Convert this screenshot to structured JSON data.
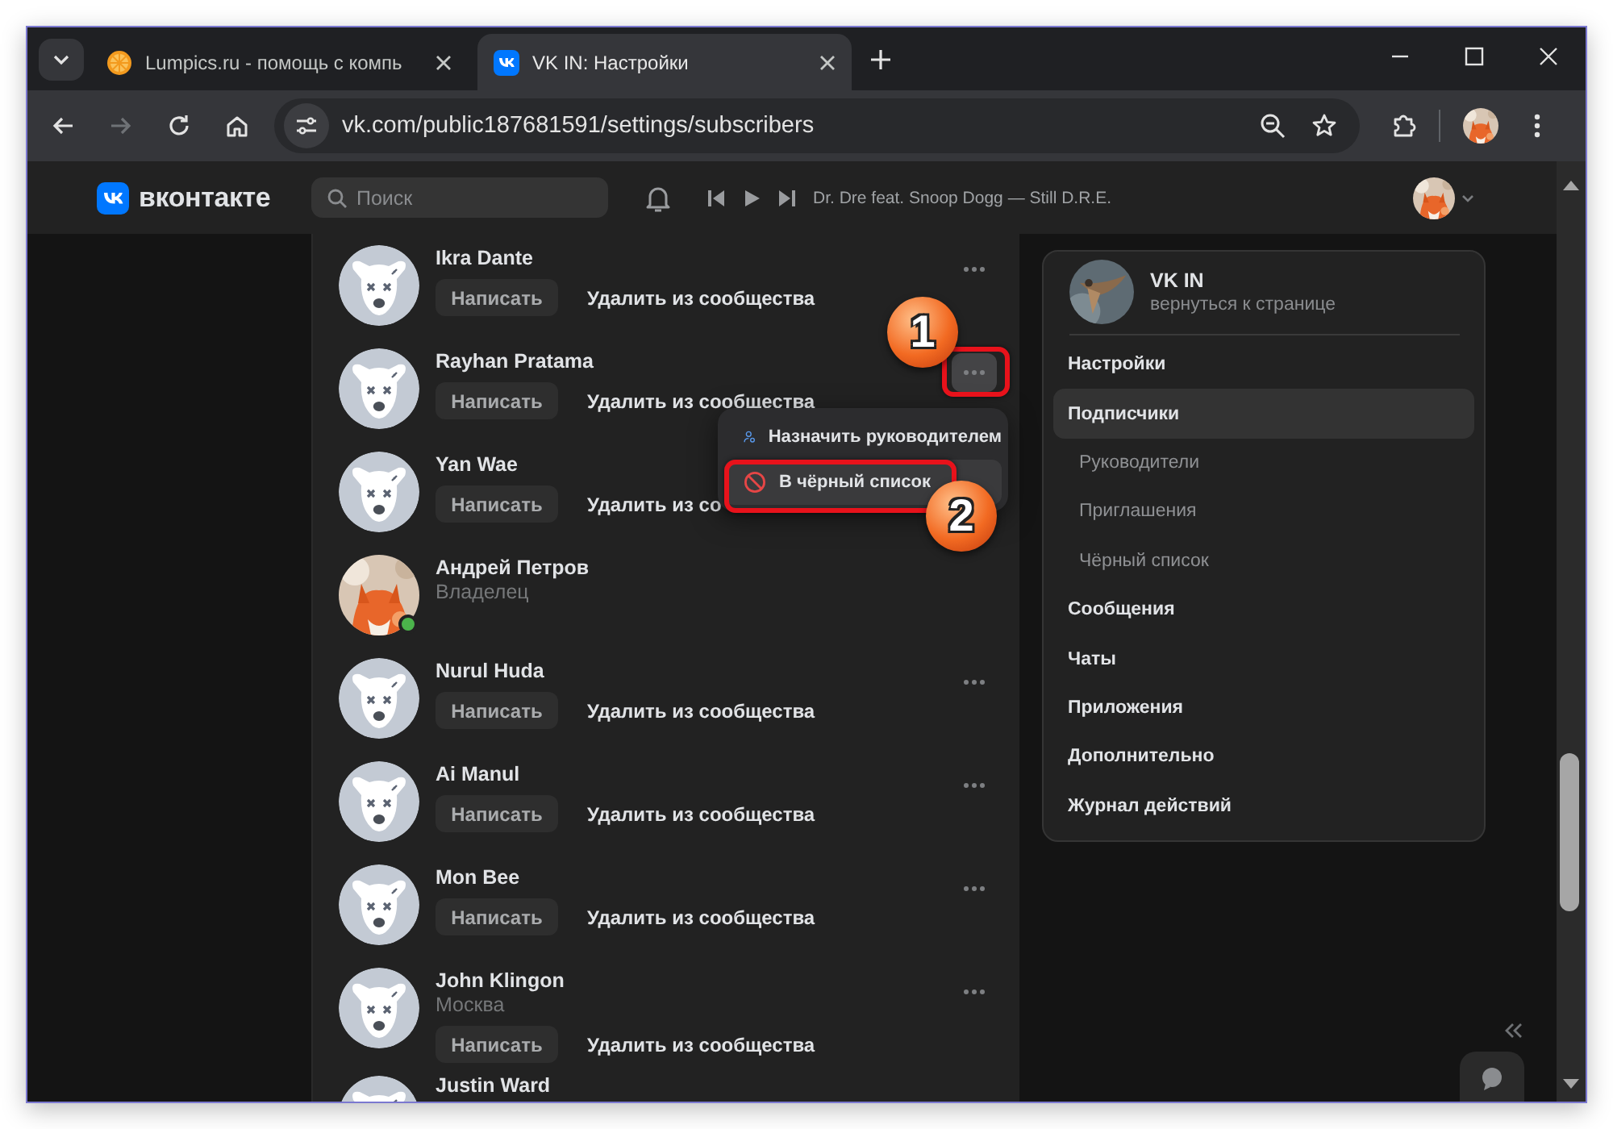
{
  "browser": {
    "tabs": [
      {
        "kind": "lumpics",
        "title": "Lumpics.ru - помощь с компь",
        "selected": false
      },
      {
        "kind": "vk",
        "title": "VK IN: Настройки",
        "selected": true
      }
    ],
    "forward_disabled": true,
    "url": "vk.com/public187681591/settings/subscribers"
  },
  "header": {
    "logo": "вконтакте",
    "search": {
      "placeholder": "Поиск"
    },
    "player": {
      "track": "Dr. Dre feat. Snoop Dogg — Still D.R.E."
    }
  },
  "members": [
    {
      "kind": "member",
      "name": "Ikra Dante",
      "online": false,
      "menu_open": false,
      "actions": [
        "Написать",
        "Удалить из сообщества"
      ]
    },
    {
      "kind": "member",
      "name": "Rayhan Pratama",
      "online": false,
      "menu_open": true,
      "actions": [
        "Написать",
        "Удалить из сообщества"
      ]
    },
    {
      "kind": "member",
      "name": "Yan Wae",
      "online": false,
      "actions": [
        "Написать",
        "Удалить из со"
      ]
    },
    {
      "kind": "owner",
      "name": "Андрей Петров",
      "subtitle": "Владелец",
      "online": true
    },
    {
      "kind": "member",
      "name": "Nurul Huda",
      "online": false,
      "menu_open": false,
      "actions": [
        "Написать",
        "Удалить из сообщества"
      ]
    },
    {
      "kind": "member",
      "name": "Ai Manul",
      "online": false,
      "menu_open": false,
      "actions": [
        "Написать",
        "Удалить из сообщества"
      ]
    },
    {
      "kind": "member",
      "name": "Mon Bee",
      "online": false,
      "menu_open": false,
      "actions": [
        "Написать",
        "Удалить из сообщества"
      ]
    },
    {
      "kind": "member",
      "name": "John Klingon",
      "subtitle": "Москва",
      "online": false,
      "menu_open": false,
      "actions": [
        "Написать",
        "Удалить из сообщества"
      ]
    },
    {
      "kind": "member",
      "name": "Justin Ward",
      "online": false
    }
  ],
  "context_menu": {
    "items": [
      {
        "kind": "assign",
        "label": "Назначить руководителем",
        "hovered": false
      },
      {
        "kind": "block",
        "label": "В чёрный список",
        "hovered": true
      }
    ]
  },
  "annotations": [
    {
      "label": "1"
    },
    {
      "label": "2"
    }
  ],
  "side_menu": {
    "group": {
      "name": "VK IN",
      "subtitle": "вернуться к странице"
    },
    "items": [
      {
        "label": "Настройки",
        "selected": false
      },
      {
        "label": "Подписчики",
        "selected": true,
        "children": [
          {
            "label": "Руководители",
            "selected": false
          },
          {
            "label": "Приглашения",
            "selected": false
          },
          {
            "label": "Чёрный список",
            "selected": false
          }
        ]
      },
      {
        "label": "Сообщения",
        "selected": false
      },
      {
        "label": "Чаты",
        "selected": false
      },
      {
        "label": "Приложения",
        "selected": false
      },
      {
        "label": "Дополнительно",
        "selected": false
      },
      {
        "label": "Журнал действий",
        "selected": false
      }
    ]
  }
}
